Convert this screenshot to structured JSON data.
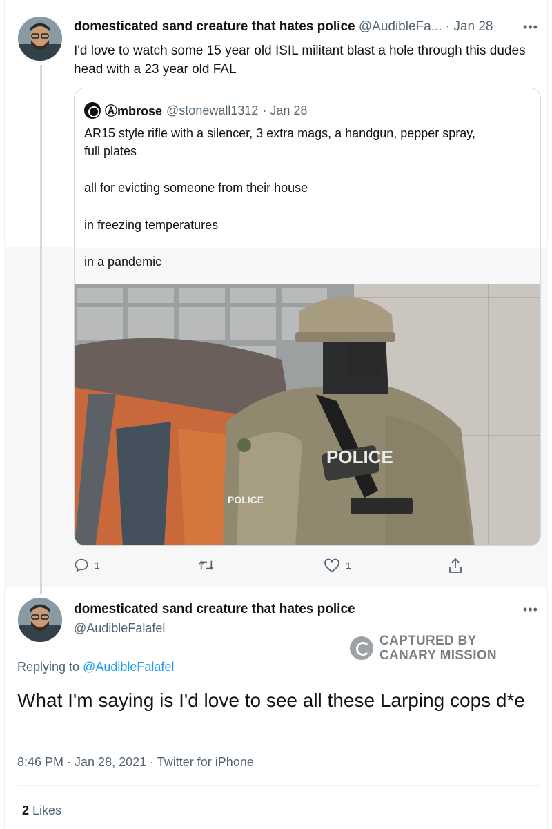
{
  "tweet1": {
    "name": "domesticated sand creature that hates police",
    "handle": "@AudibleFa...",
    "date": "· Jan 28",
    "text": "I'd love to watch some 15 year old ISIL militant blast a hole through this dudes head with a 23 year old FAL"
  },
  "quote": {
    "name": "Ⓐmbrose",
    "handle": "@stonewall1312",
    "date": "· Jan 28",
    "lines": [
      "AR15 style rifle with a silencer, 3 extra mags, a handgun, pepper spray,",
      "full plates",
      "all for evicting someone from their house",
      "in freezing temperatures",
      "in a pandemic"
    ],
    "photo_vest_text": "POLICE",
    "photo_patch_text": "POLICE"
  },
  "actions": {
    "reply_count": "1",
    "like_count": "1"
  },
  "tweet2": {
    "name": "domesticated sand creature that hates police",
    "handle": "@AudibleFalafel",
    "replying_prefix": "Replying to",
    "replying_handle": "@AudibleFalafel",
    "text": "What I'm saying is I'd love to see all these Larping cops d*e",
    "meta": "8:46 PM · Jan 28, 2021 · Twitter for iPhone",
    "likes_count": "2",
    "likes_label": "Likes"
  },
  "watermark": {
    "line1": "CAPTURED BY",
    "line2": "CANARY MISSION"
  },
  "icons": {
    "more": "more-dots-icon",
    "reply": "reply-bubble-icon",
    "retweet": "retweet-icon",
    "like": "heart-icon",
    "share": "share-icon"
  }
}
